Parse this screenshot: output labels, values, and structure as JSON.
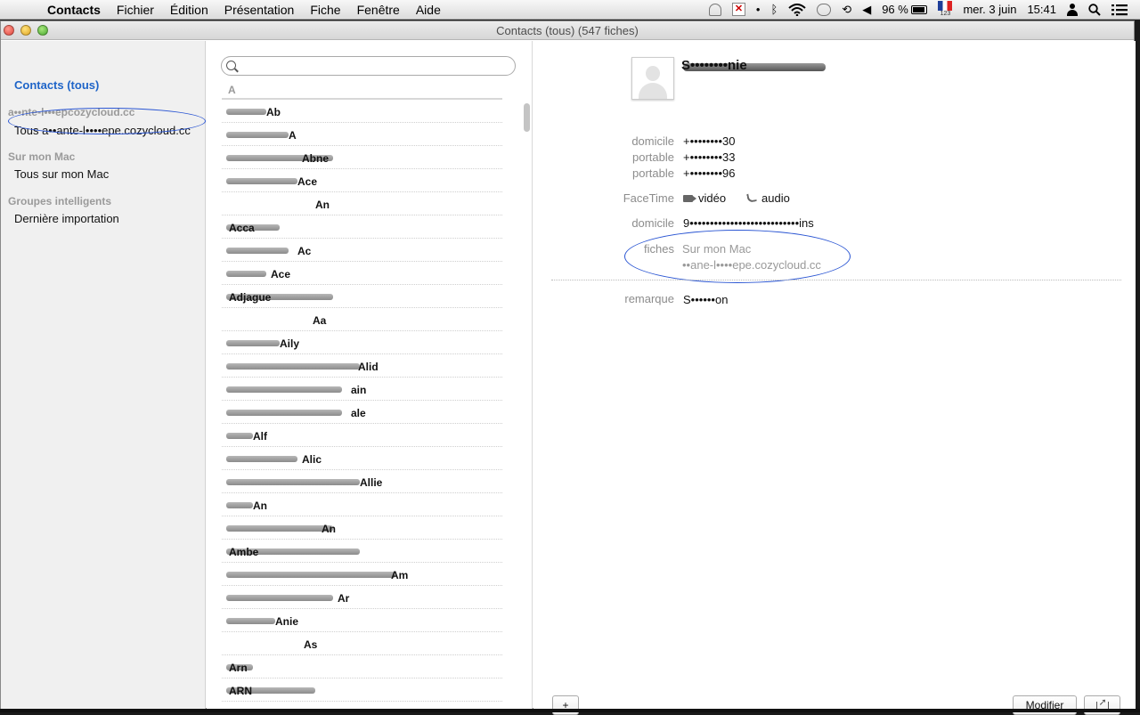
{
  "menubar": {
    "apple_icon": "",
    "app_name": "Contacts",
    "menus": [
      "Fichier",
      "Édition",
      "Présentation",
      "Fiche",
      "Fenêtre",
      "Aide"
    ],
    "battery": "96 %",
    "flag_badge": "123",
    "date": "mer. 3 juin",
    "time": "15:41"
  },
  "window": {
    "title": "Contacts (tous) (547 fiches)"
  },
  "sidebar": {
    "all_contacts": "Contacts (tous)",
    "account_header": "a••nte-l•••epcozycloud.cc",
    "account_item": "Tous a••ante-l••••epe.cozycloud.cc",
    "mac_header": "Sur mon Mac",
    "mac_item": "Tous sur mon Mac",
    "smart_header": "Groupes intelligents",
    "smart_item": "Dernière importation"
  },
  "list": {
    "search_placeholder": "",
    "section_letter": "A",
    "rows": [
      "Ab",
      "A",
      "Abne",
      "Ace",
      "An",
      "Acca",
      "Ac",
      "Ace",
      "Adjague",
      "Aa",
      "Aily",
      "Alid",
      "ain",
      "ale",
      "Alf",
      "Alic",
      "Allie",
      "An",
      "An",
      "Ambe",
      "Am",
      "Ar",
      "Anie",
      "As",
      "Arn",
      "ARN"
    ]
  },
  "detail": {
    "name": "S••••••••nie",
    "fields": [
      {
        "label": "domicile",
        "value": "+••••••••30"
      },
      {
        "label": "portable",
        "value": "+••••••••33"
      },
      {
        "label": "portable",
        "value": "+••••••••96"
      }
    ],
    "facetime_label": "FaceTime",
    "facetime_video": "vidéo",
    "facetime_audio": "audio",
    "address_label": "domicile",
    "address_value": "9•••••••••••••••••••••••••••ins",
    "cards_label": "fiches",
    "cards_mac": "Sur mon Mac",
    "cards_account": "••ane-l••••epe.cozycloud.cc",
    "note_label": "remarque",
    "note_value": "S••••••on",
    "add_button": "+",
    "edit_button": "Modifier"
  }
}
